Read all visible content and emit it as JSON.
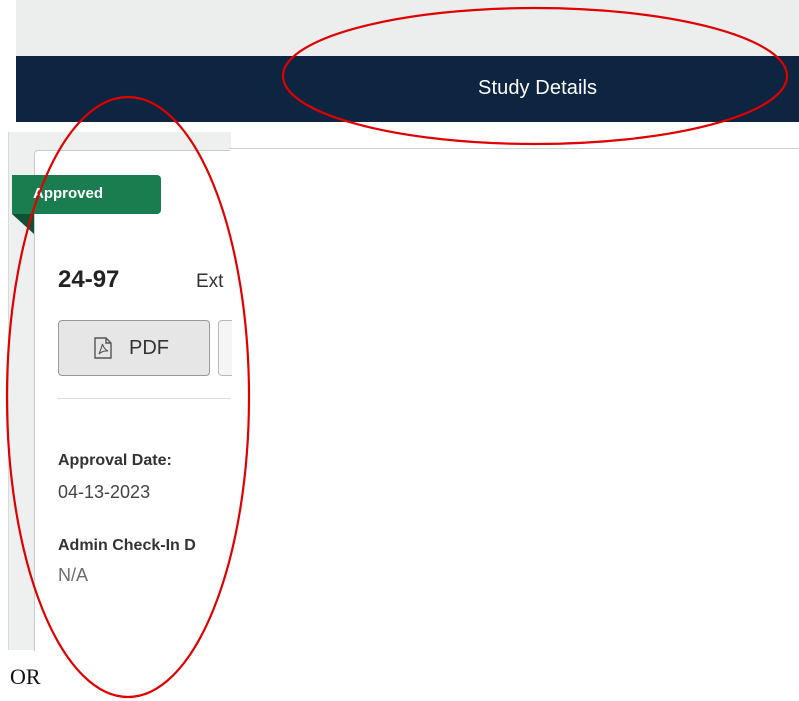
{
  "header": {
    "title": "Study Details"
  },
  "card": {
    "status_badge": "Approved",
    "study_id": "24-97",
    "study_title_fragment": "Ext",
    "pdf_button_label": "PDF",
    "fields": [
      {
        "label": "Approval Date:",
        "value": "04-13-2023"
      },
      {
        "label": "Admin Check-In D",
        "value": "N/A"
      }
    ]
  },
  "footer": {
    "text": "OR"
  },
  "colors": {
    "header_bg": "#0e2542",
    "badge_bg": "#1a7d4f",
    "annotation": "#e00000"
  },
  "icons": {
    "pdf": "pdf-file-icon"
  }
}
